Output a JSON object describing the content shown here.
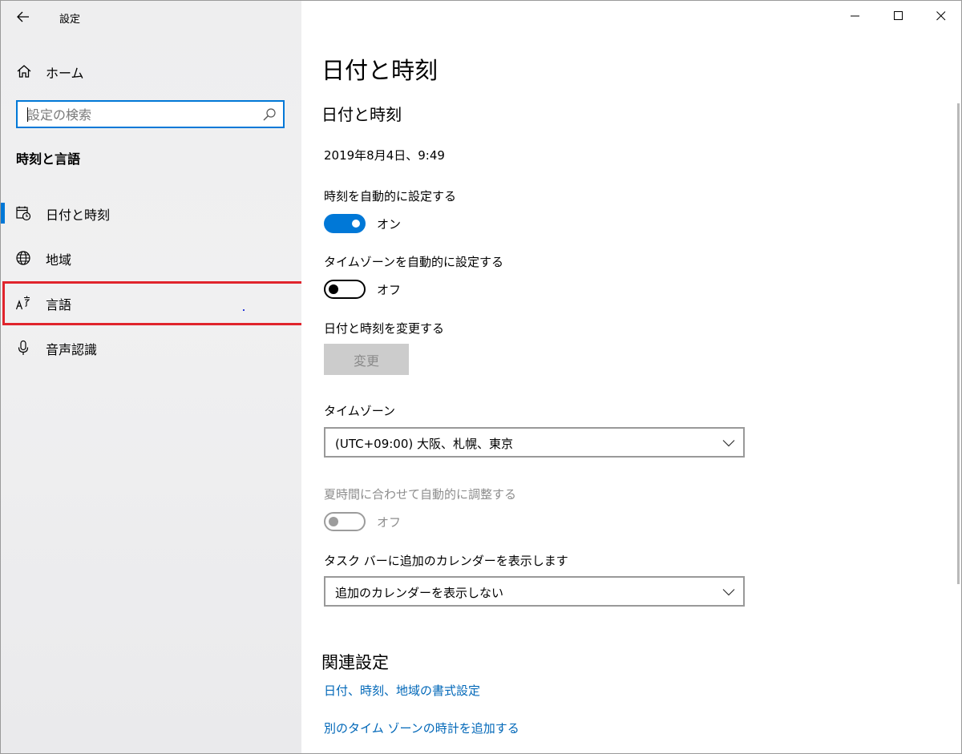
{
  "window": {
    "title": "設定"
  },
  "sidebar": {
    "home_label": "ホーム",
    "search_placeholder": "設定の検索",
    "section_title": "時刻と言語",
    "items": [
      {
        "label": "日付と時刻",
        "icon": "calendar-clock-icon",
        "active": true
      },
      {
        "label": "地域",
        "icon": "globe-icon",
        "active": false
      },
      {
        "label": "言語",
        "icon": "language-icon",
        "active": false
      },
      {
        "label": "音声認識",
        "icon": "microphone-icon",
        "active": false
      }
    ]
  },
  "main": {
    "page_title": "日付と時刻",
    "section_title": "日付と時刻",
    "current_datetime": "2019年8月4日、9:49",
    "auto_time": {
      "label": "時刻を自動的に設定する",
      "state_text": "オン",
      "on": true
    },
    "auto_timezone": {
      "label": "タイムゾーンを自動的に設定する",
      "state_text": "オフ",
      "on": false
    },
    "change_datetime": {
      "label": "日付と時刻を変更する",
      "button": "変更"
    },
    "timezone": {
      "label": "タイムゾーン",
      "value": "(UTC+09:00) 大阪、札幌、東京"
    },
    "dst": {
      "label": "夏時間に合わせて自動的に調整する",
      "state_text": "オフ",
      "disabled": true
    },
    "calendar": {
      "label": "タスク バーに追加のカレンダーを表示します",
      "value": "追加のカレンダーを表示しない"
    },
    "related": {
      "title": "関連設定",
      "links": [
        "日付、時刻、地域の書式設定",
        "別のタイム ゾーンの時計を追加する"
      ]
    }
  },
  "colors": {
    "accent": "#0078d7",
    "highlight": "#e0242c",
    "link": "#0067b8"
  }
}
